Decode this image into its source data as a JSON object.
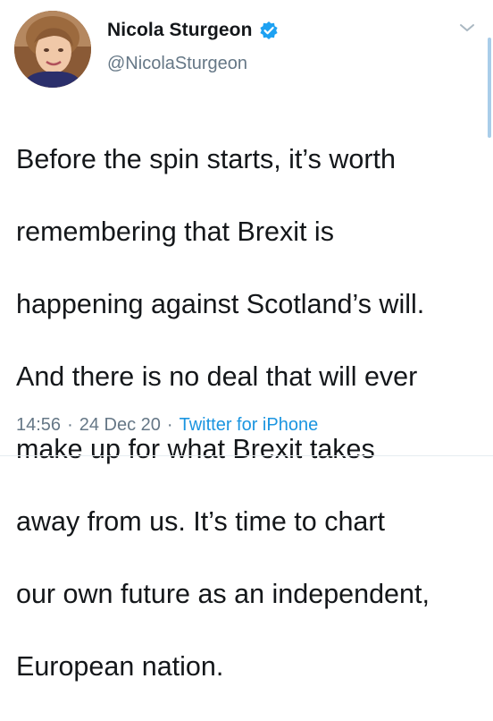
{
  "author": {
    "display_name": "Nicola Sturgeon",
    "handle": "@NicolaSturgeon",
    "verified": true,
    "avatar_icon": "profile-photo"
  },
  "tweet": {
    "lines": [
      "Before the spin starts, it’s worth",
      "remembering that Brexit is",
      "happening against Scotland’s will.",
      "And there is no deal that will ever",
      "make up for what Brexit takes",
      "away from us. It’s time to chart",
      "our own future as an independent,",
      "European nation."
    ]
  },
  "meta": {
    "time": "14:56",
    "separator": "·",
    "date": "24 Dec 20",
    "source": "Twitter for iPhone"
  },
  "icons": {
    "verified": "verified-badge-icon",
    "menu": "chevron-down-icon"
  },
  "colors": {
    "text": "#14171a",
    "secondary": "#657786",
    "accent": "#1b95e0",
    "verified": "#1da1f2"
  }
}
